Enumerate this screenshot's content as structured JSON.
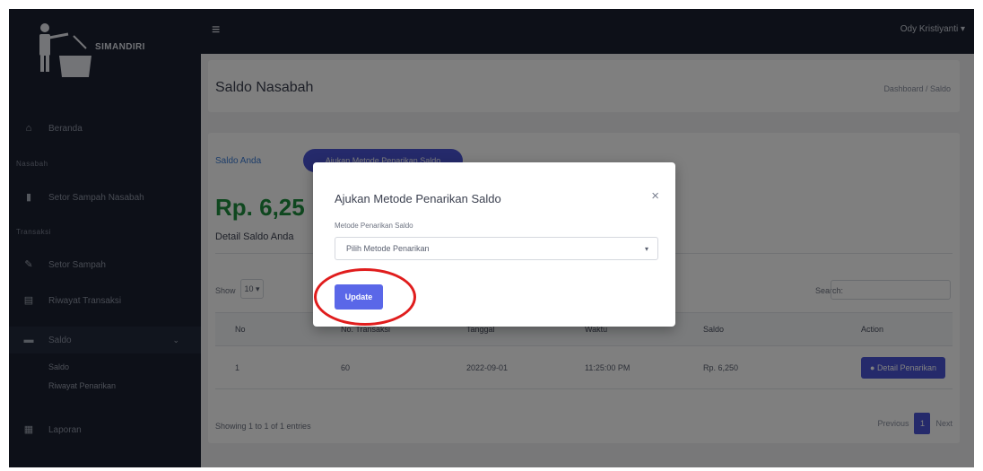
{
  "app": {
    "logo_text": "SIMANDIRI"
  },
  "sidebar": {
    "dashboard_label": "Beranda",
    "section_1": "Nasabah",
    "item_2": "Setor Sampah Nasabah",
    "section_2": "Transaksi",
    "item_3": "Setor Sampah",
    "item_4": "Riwayat Transaksi",
    "item_5": "Saldo",
    "sub_1": "Saldo",
    "sub_2": "Riwayat Penarikan",
    "item_6": "Laporan"
  },
  "topbar": {
    "user_name": "Ody Kristiyanti ▾"
  },
  "page": {
    "title": "Saldo Nasabah",
    "breadcrumb": "Dashboard / Saldo"
  },
  "card": {
    "saldo_anda": "Saldo Anda",
    "ajukan_btn": "Ajukan Metode Penarikan Saldo",
    "balance": "Rp. 6,25",
    "detail_title": "Detail Saldo Anda",
    "show_label": "Show",
    "show_value": "10 ▾",
    "search_label": "Search:"
  },
  "table": {
    "headers": [
      "No",
      "No. Transaksi",
      "Tanggal",
      "Waktu",
      "Saldo",
      "Action"
    ],
    "rows": [
      {
        "no": "1",
        "id": "60",
        "tanggal": "2022-09-01",
        "waktu": "11:25:00 PM",
        "saldo": "Rp. 6,250",
        "action": "Detail Penarikan"
      }
    ],
    "showing": "Showing 1 to 1 of 1 entries",
    "pager_prev": "Previous",
    "pager_page": "1",
    "pager_next": "Next"
  },
  "modal": {
    "title": "Ajukan Metode Penarikan Saldo",
    "close": "×",
    "label": "Metode Penarikan Saldo",
    "select_placeholder": "Pilih Metode Penarikan",
    "update_btn": "Update"
  }
}
